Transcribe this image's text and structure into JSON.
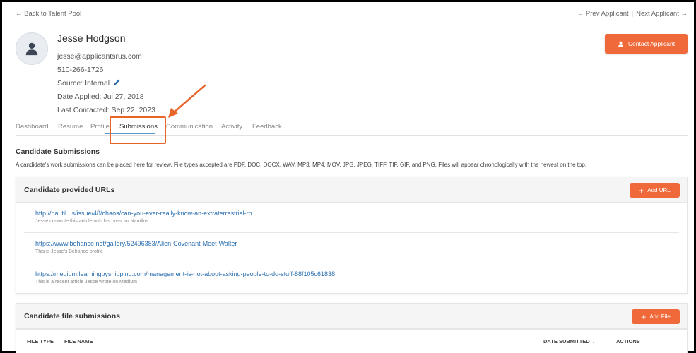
{
  "nav": {
    "back": "← Back to Talent Pool",
    "prev": "← Prev Applicant",
    "separator": "|",
    "next": "Next Applicant →"
  },
  "applicant": {
    "name": "Jesse Hodgson",
    "email": "jesse@applicantsrus.com",
    "phone": "510-266-1726",
    "source": "Source: Internal",
    "date_applied": "Date Applied: Jul 27, 2018",
    "last_contacted": "Last Contacted: Sep 22, 2023"
  },
  "contact_button": "Contact Applicant",
  "tabs": [
    {
      "label": "Dashboard"
    },
    {
      "label": "Resume"
    },
    {
      "label": "Profile"
    },
    {
      "label": "Submissions"
    },
    {
      "label": "Communication"
    },
    {
      "label": "Activity"
    },
    {
      "label": "Feedback"
    }
  ],
  "submissions": {
    "title": "Candidate Submissions",
    "description": "A candidate's work submissions can be placed here for review. File types accepted are PDF, DOC, DOCX, WAV, MP3, MP4, MOV, JPG, JPEG, TIFF, TIF, GIF, and PNG. Files will appear chronologically with the newest on the top."
  },
  "urls_card": {
    "title": "Candidate provided URLs",
    "button": "Add URL",
    "items": [
      {
        "url": "http://nautil.us/issue/48/chaos/can-you-ever-really-know-an-extraterrestrial-rp",
        "note": "Jesse co-wrote this article with his boss for Nautilus"
      },
      {
        "url": "https://www.behance.net/gallery/52496383/Alien-Covenant-Meet-Walter",
        "note": "This is Jesse's Behance profile"
      },
      {
        "url": "https://medium.learningbyshipping.com/management-is-not-about-asking-people-to-do-stuff-88f105c61838",
        "note": "This is a recent article Jesse wrote on Medium"
      }
    ]
  },
  "files_card": {
    "title": "Candidate file submissions",
    "button": "Add File",
    "columns": {
      "file_type": "FILE TYPE",
      "file_name": "FILE NAME",
      "date_submitted": "DATE SUBMITTED",
      "actions": "ACTIONS"
    }
  },
  "colors": {
    "accent": "#f0693a",
    "link": "#2a6fb0",
    "highlight": "#e8652a"
  }
}
